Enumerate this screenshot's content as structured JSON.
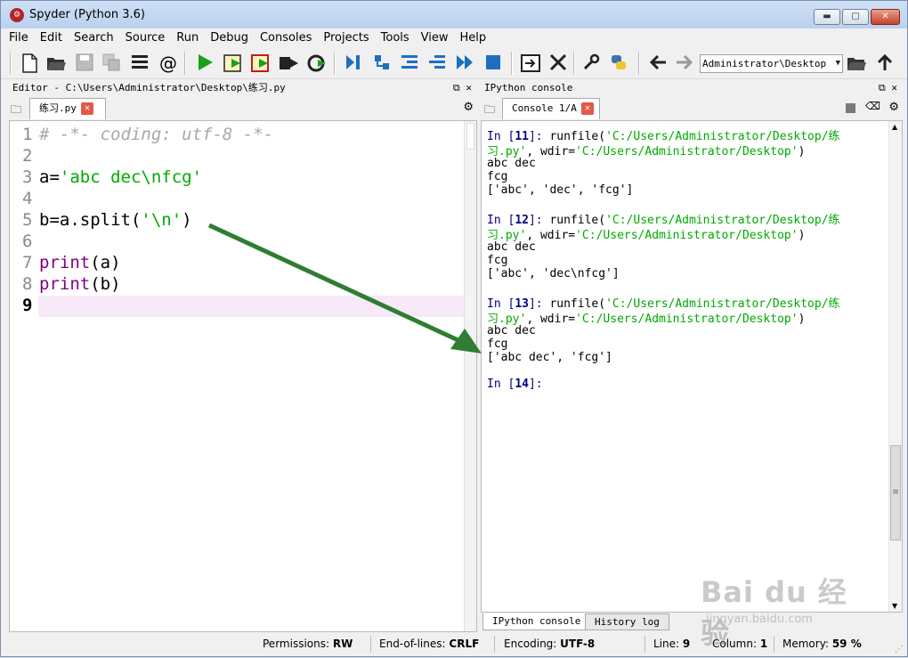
{
  "window": {
    "title": "Spyder (Python 3.6)",
    "min": "▬",
    "max": "▢",
    "close": "✕"
  },
  "menu": [
    "File",
    "Edit",
    "Search",
    "Source",
    "Run",
    "Debug",
    "Consoles",
    "Projects",
    "Tools",
    "View",
    "Help"
  ],
  "toolbar": {
    "icons": [
      "new-file-icon",
      "open-folder-icon",
      "save-icon",
      "save-all-icon",
      "outline-icon",
      "at-icon",
      "run-icon",
      "run-cell-icon",
      "run-cell-advance-icon",
      "run-selection-icon",
      "rerun-icon",
      "debug-icon",
      "step-icon",
      "step-into-icon",
      "step-return-icon",
      "continue-icon",
      "stop-debug-icon",
      "maximize-pane-icon",
      "fullscreen-icon",
      "preferences-icon",
      "python-path-icon",
      "back-icon",
      "forward-icon",
      "browse-folder-icon",
      "parent-dir-icon"
    ],
    "path": "Administrator\\Desktop"
  },
  "editor": {
    "header": "Editor - C:\\Users\\Administrator\\Desktop\\练习.py",
    "tab": "练习.py",
    "lines": [
      {
        "n": "1",
        "text": "# -*- coding: utf-8 -*-"
      },
      {
        "n": "2",
        "text": ""
      },
      {
        "n": "3",
        "text": "a='abc dec\\nfcg'"
      },
      {
        "n": "4",
        "text": ""
      },
      {
        "n": "5",
        "text": "b=a.split('\\n')"
      },
      {
        "n": "6",
        "text": ""
      },
      {
        "n": "7",
        "text": "print(a)"
      },
      {
        "n": "8",
        "text": "print(b)"
      },
      {
        "n": "9",
        "text": ""
      }
    ],
    "current_line": "9"
  },
  "console": {
    "header": "IPython console",
    "tab": "Console 1/A",
    "blocks": [
      {
        "prompt_num": "11",
        "call": "runfile(",
        "path1": "'C:/Users/Administrator/Desktop/练",
        "path2": "习.py'",
        "wdir": ", wdir=",
        "wdir_val": "'C:/Users/Administrator/Desktop'",
        "close": ")",
        "out": [
          "abc dec",
          "fcg",
          "['abc', 'dec', 'fcg']"
        ]
      },
      {
        "prompt_num": "12",
        "call": "runfile(",
        "path1": "'C:/Users/Administrator/Desktop/练",
        "path2": "习.py'",
        "wdir": ", wdir=",
        "wdir_val": "'C:/Users/Administrator/Desktop'",
        "close": ")",
        "out": [
          "abc dec",
          "fcg",
          "['abc', 'dec\\nfcg']"
        ]
      },
      {
        "prompt_num": "13",
        "call": "runfile(",
        "path1": "'C:/Users/Administrator/Desktop/练",
        "path2": "习.py'",
        "wdir": ", wdir=",
        "wdir_val": "'C:/Users/Administrator/Desktop'",
        "close": ")",
        "out": [
          "abc dec",
          "fcg",
          "['abc dec', 'fcg']"
        ]
      }
    ],
    "last_prompt_num": "14",
    "bottom_tabs": [
      "IPython console",
      "History log"
    ]
  },
  "status": {
    "permissions_label": "Permissions:",
    "permissions": "RW",
    "eol_label": "End-of-lines:",
    "eol": "CRLF",
    "encoding_label": "Encoding:",
    "encoding": "UTF-8",
    "line_label": "Line:",
    "line": "9",
    "column_label": "Column:",
    "column": "1",
    "memory_label": "Memory:",
    "memory": "59 %"
  },
  "watermark": {
    "big": "Bai du 经验",
    "small": "jingyan.baidu.com"
  },
  "annotation": {
    "arrow_color": "#2e7d32"
  }
}
